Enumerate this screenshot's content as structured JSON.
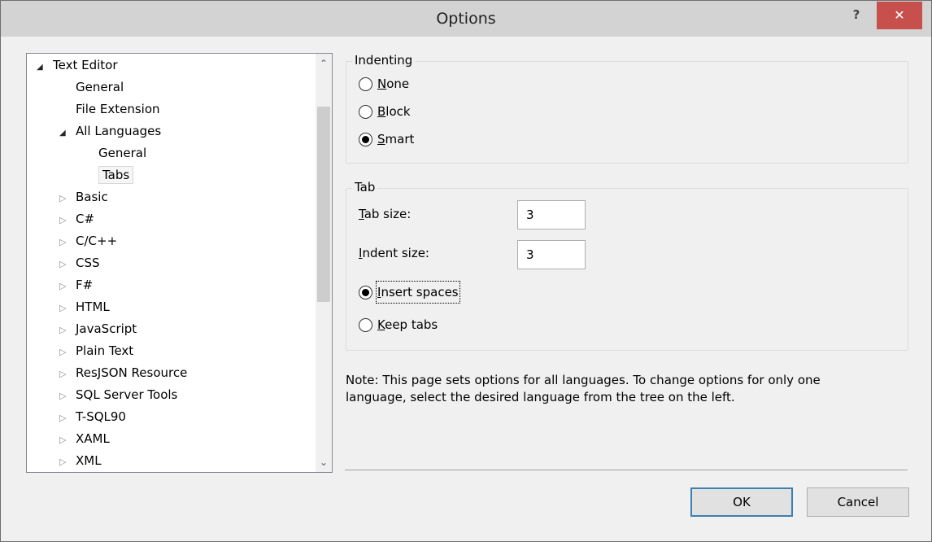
{
  "window": {
    "title": "Options",
    "help_label": "?",
    "close_label": "✕"
  },
  "tree": {
    "items": [
      {
        "label": "Text Editor",
        "state": "open"
      },
      {
        "label": "General",
        "state": "leaf"
      },
      {
        "label": "File Extension",
        "state": "leaf"
      },
      {
        "label": "All Languages",
        "state": "open"
      },
      {
        "label": "General",
        "state": "leaf"
      },
      {
        "label": "Tabs",
        "state": "leaf-selected"
      },
      {
        "label": "Basic",
        "state": "closed"
      },
      {
        "label": "C#",
        "state": "closed"
      },
      {
        "label": "C/C++",
        "state": "closed"
      },
      {
        "label": "CSS",
        "state": "closed"
      },
      {
        "label": "F#",
        "state": "closed"
      },
      {
        "label": "HTML",
        "state": "closed"
      },
      {
        "label": "JavaScript",
        "state": "closed"
      },
      {
        "label": "Plain Text",
        "state": "closed"
      },
      {
        "label": "ResJSON Resource",
        "state": "closed"
      },
      {
        "label": "SQL Server Tools",
        "state": "closed"
      },
      {
        "label": "T-SQL90",
        "state": "closed"
      },
      {
        "label": "XAML",
        "state": "closed"
      },
      {
        "label": "XML",
        "state": "closed"
      }
    ]
  },
  "indenting": {
    "legend": "Indenting",
    "options": [
      {
        "underline": "N",
        "rest": "one",
        "checked": false
      },
      {
        "underline": "B",
        "rest": "lock",
        "checked": false
      },
      {
        "underline": "S",
        "rest": "mart",
        "checked": true
      }
    ]
  },
  "tab": {
    "legend": "Tab",
    "tab_size_u": "T",
    "tab_size_rest": "ab size:",
    "tab_size_value": "3",
    "indent_size_u": "I",
    "indent_size_rest": "ndent size:",
    "indent_size_value": "3",
    "insert_spaces_u": "I",
    "insert_spaces_rest": "nsert spaces",
    "insert_spaces_checked": true,
    "keep_tabs_u": "K",
    "keep_tabs_rest": "eep tabs",
    "keep_tabs_checked": false
  },
  "note": "Note: This page sets options for all languages. To change options for only one language, select the desired language from the tree on the left.",
  "buttons": {
    "ok": "OK",
    "cancel": "Cancel"
  }
}
